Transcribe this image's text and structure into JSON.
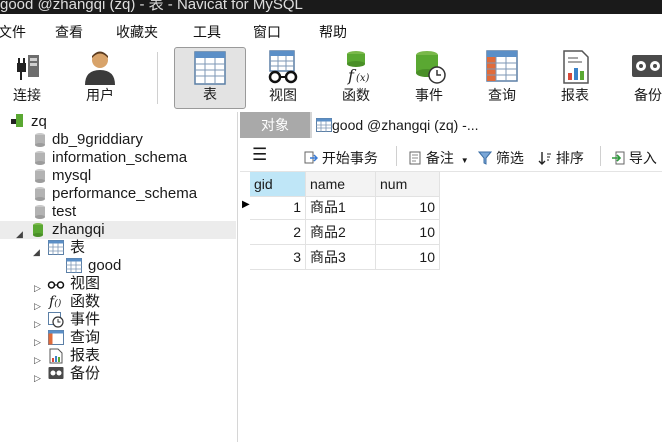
{
  "window": {
    "title": "good @zhangqi (zq) - 表 - Navicat for MySQL"
  },
  "menu": [
    "文件",
    "查看",
    "收藏夹",
    "工具",
    "窗口",
    "帮助"
  ],
  "toolbar": [
    {
      "label": "连接",
      "icon": "connection-icon"
    },
    {
      "label": "用户",
      "icon": "user-icon"
    },
    {
      "label": "表",
      "icon": "table-icon",
      "active": true
    },
    {
      "label": "视图",
      "icon": "view-icon"
    },
    {
      "label": "函数",
      "icon": "function-icon"
    },
    {
      "label": "事件",
      "icon": "event-icon"
    },
    {
      "label": "查询",
      "icon": "query-icon"
    },
    {
      "label": "报表",
      "icon": "report-icon"
    },
    {
      "label": "备份",
      "icon": "backup-icon"
    }
  ],
  "tree": {
    "connection": "zq",
    "databases": [
      "db_9griddiary",
      "information_schema",
      "mysql",
      "performance_schema",
      "test"
    ],
    "open_db": "zhangqi",
    "tables_label": "表",
    "table": "good",
    "groups": [
      "视图",
      "函数",
      "事件",
      "查询",
      "报表",
      "备份"
    ]
  },
  "tabs": {
    "objects": "对象",
    "table_tab": "good @zhangqi (zq) -..."
  },
  "subtoolbar": {
    "begin_tx": "开始事务",
    "memo": "备注",
    "filter": "筛选",
    "sort": "排序",
    "import": "导入"
  },
  "grid": {
    "columns": [
      "gid",
      "name",
      "num"
    ],
    "rows": [
      {
        "gid": "1",
        "name": "商品1",
        "num": "10"
      },
      {
        "gid": "2",
        "name": "商品2",
        "num": "10"
      },
      {
        "gid": "3",
        "name": "商品3",
        "num": "10"
      }
    ]
  },
  "colors": {
    "accent": "#bfe6f7",
    "db_green": "#5aa832",
    "toolbar_active": "#e3e3e3"
  }
}
